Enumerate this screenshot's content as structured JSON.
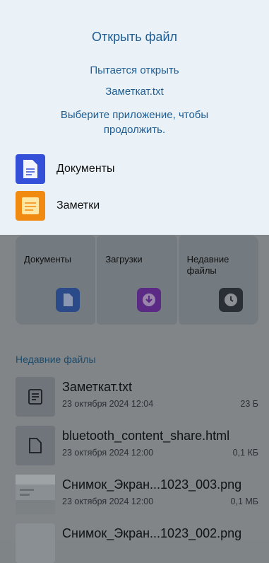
{
  "dialog": {
    "title": "Открыть файл",
    "line1": "Пытается открыть",
    "filename": "Заметкат.txt",
    "prompt": "Выберите приложение, чтобы продолжить.",
    "apps": [
      {
        "label": "Документы",
        "icon": "docs-app-icon"
      },
      {
        "label": "Заметки",
        "icon": "notes-app-icon"
      }
    ]
  },
  "categories": [
    {
      "label": "Документы",
      "icon": "document-icon"
    },
    {
      "label": "Загрузки",
      "icon": "download-icon"
    },
    {
      "label": "Недавние файлы",
      "icon": "clock-icon"
    }
  ],
  "recent": {
    "title": "Недавние файлы",
    "files": [
      {
        "name": "Заметкат.txt",
        "date": "23 октября 2024 12:04",
        "size": "23 Б",
        "thumb": "text-file-icon"
      },
      {
        "name": "bluetooth_content_share.html",
        "date": "23 октября 2024 12:00",
        "size": "0,1 КБ",
        "thumb": "file-icon"
      },
      {
        "name": "Снимок_Экран...1023_003.png",
        "date": "23 октября 2024 12:00",
        "size": "0,1 МБ",
        "thumb": "image-thumbnail"
      },
      {
        "name": "Снимок_Экран...1023_002.png",
        "date": "",
        "size": "",
        "thumb": "image-thumbnail"
      }
    ]
  },
  "colors": {
    "accent": "#1f5d92",
    "dialog_bg": "#eaf2f8",
    "scrim": "#818587"
  }
}
